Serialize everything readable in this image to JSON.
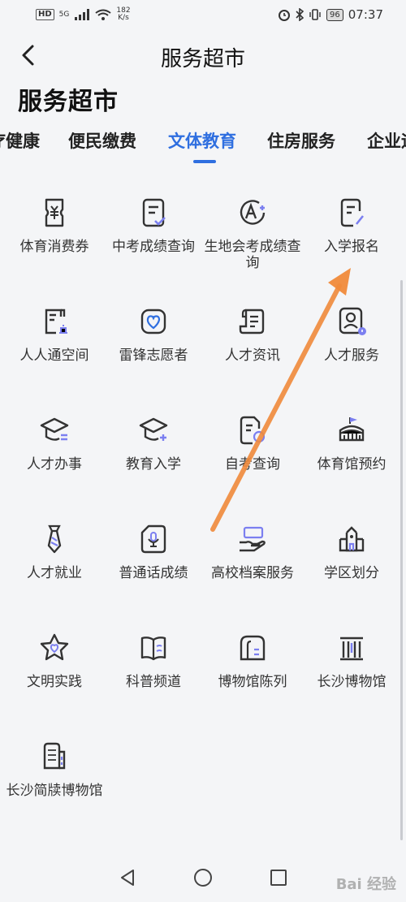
{
  "status_bar": {
    "left_badge": "HD",
    "network_type": "5G",
    "network_speed_value": "182",
    "network_speed_unit": "K/s",
    "battery": "96",
    "time": "07:37"
  },
  "header": {
    "title": "服务超市"
  },
  "page": {
    "heading": "服务超市"
  },
  "tabs": [
    {
      "label": "疗健康"
    },
    {
      "label": "便民缴费"
    },
    {
      "label": "文体教育",
      "active": true
    },
    {
      "label": "住房服务"
    },
    {
      "label": "企业运"
    }
  ],
  "services": [
    {
      "label": "体育消费券",
      "icon": "voucher-icon"
    },
    {
      "label": "中考成绩查询",
      "icon": "score-document-icon"
    },
    {
      "label": "生地会考成绩查询",
      "icon": "grade-a-plus-icon"
    },
    {
      "label": "入学报名",
      "icon": "enrollment-form-icon"
    },
    {
      "label": "人人通空间",
      "icon": "space-book-icon"
    },
    {
      "label": "雷锋志愿者",
      "icon": "heart-badge-icon"
    },
    {
      "label": "人才资讯",
      "icon": "scroll-news-icon"
    },
    {
      "label": "人才服务",
      "icon": "talent-id-card-icon"
    },
    {
      "label": "人才办事",
      "icon": "graduation-cap-icon"
    },
    {
      "label": "教育入学",
      "icon": "graduation-cap-plus-icon"
    },
    {
      "label": "自考查询",
      "icon": "exam-document-icon"
    },
    {
      "label": "体育馆预约",
      "icon": "stadium-icon"
    },
    {
      "label": "人才就业",
      "icon": "necktie-icon"
    },
    {
      "label": "普通话成绩",
      "icon": "microphone-card-icon"
    },
    {
      "label": "高校档案服务",
      "icon": "archive-hand-icon"
    },
    {
      "label": "学区划分",
      "icon": "school-building-icon"
    },
    {
      "label": "文明实践",
      "icon": "star-heart-icon"
    },
    {
      "label": "科普频道",
      "icon": "open-book-icon"
    },
    {
      "label": "博物馆陈列",
      "icon": "museum-arch-icon"
    },
    {
      "label": "长沙博物馆",
      "icon": "museum-columns-icon"
    },
    {
      "label": "长沙简牍博物馆",
      "icon": "bamboo-slips-icon"
    }
  ],
  "colors": {
    "accent": "#2f6fe0",
    "icon_stroke": "#333333",
    "icon_accent": "#7b7ff0",
    "annotation_arrow": "#f08a3a"
  },
  "system_nav": {
    "back": "back-triangle-icon",
    "home": "home-circle-icon",
    "recents": "recents-square-icon"
  },
  "watermark": "Bai 经验"
}
